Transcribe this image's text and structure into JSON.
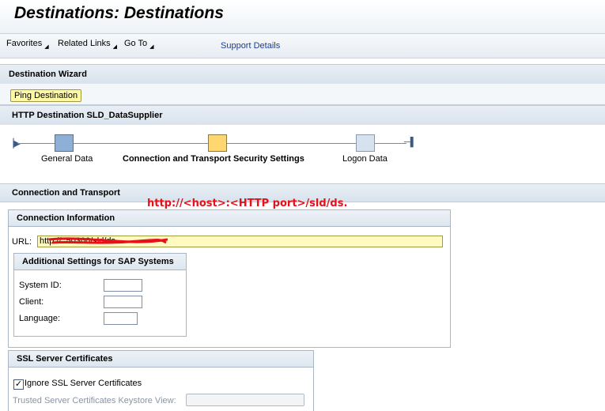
{
  "title": "Destinations: Destinations",
  "menu": {
    "items": [
      {
        "label": "Favorites"
      },
      {
        "label": "Related Links"
      },
      {
        "label": "Go To"
      }
    ],
    "support": "Support Details"
  },
  "wizard": {
    "title": "Destination Wizard",
    "ping_button": "Ping Destination"
  },
  "destination_header": "HTTP Destination SLD_DataSupplier",
  "roadmap": {
    "steps": [
      {
        "label": "General Data",
        "state": "visited",
        "color": "#8eb0d6"
      },
      {
        "label": "Connection and Transport Security Settings",
        "state": "current",
        "color": "#ffd770"
      },
      {
        "label": "Logon Data",
        "state": "upcoming",
        "color": "#d6e2ee"
      }
    ]
  },
  "connection_transport": {
    "title": "Connection and Transport",
    "annotation": "http://<host>:<HTTP port>/sld/ds."
  },
  "connection_info": {
    "title": "Connection Information",
    "url_label": "URL:",
    "url_value": "http://                                         :50300/sld/ds"
  },
  "sap_settings": {
    "title": "Additional Settings for SAP Systems",
    "fields": [
      {
        "label": "System ID:",
        "value": ""
      },
      {
        "label": "Client:",
        "value": ""
      },
      {
        "label": "Language:",
        "value": ""
      }
    ]
  },
  "ssl": {
    "title": "SSL Server Certificates",
    "ignore_label": "Ignore SSL Server Certificates",
    "ignore_checked": "✓",
    "keystore_label": "Trusted Server Certificates Keystore View:",
    "keystore_value": ""
  },
  "colors": {
    "annotation": "#e8101a",
    "ping_button_bg": "#fff9a6",
    "url_input_bg": "#fffbc0",
    "link": "#1a3c9c"
  }
}
